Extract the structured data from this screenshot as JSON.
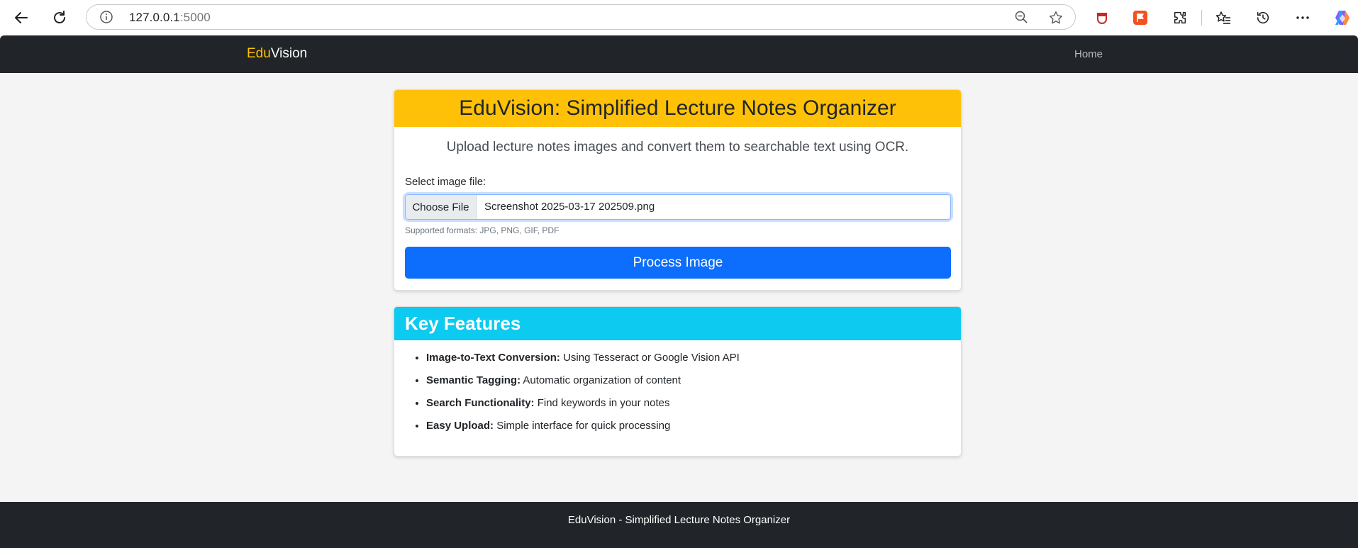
{
  "browser": {
    "url_host": "127.0.0.1",
    "url_port": ":5000",
    "icons": [
      "back-icon",
      "reload-icon",
      "info-icon",
      "zoom-out-icon",
      "star-icon",
      "shield-extension-icon",
      "flag-extension-icon",
      "puzzle-extensions-icon",
      "favorites-icon",
      "history-icon",
      "more-icon",
      "copilot-icon"
    ]
  },
  "navbar": {
    "brand_edu": "Edu",
    "brand_vision": "Vision",
    "home_link": "Home"
  },
  "upload_card": {
    "title": "EduVision: Simplified Lecture Notes Organizer",
    "lead": "Upload lecture notes images and convert them to searchable text using OCR.",
    "file_label": "Select image file:",
    "choose_button": "Choose File",
    "selected_file": "Screenshot 2025-03-17 202509.png",
    "help_text": "Supported formats: JPG, PNG, GIF, PDF",
    "submit_button": "Process Image"
  },
  "features_card": {
    "title": "Key Features",
    "items": [
      {
        "label": "Image-to-Text Conversion:",
        "text": " Using Tesseract or Google Vision API"
      },
      {
        "label": "Semantic Tagging:",
        "text": " Automatic organization of content"
      },
      {
        "label": "Search Functionality:",
        "text": " Find keywords in your notes"
      },
      {
        "label": "Easy Upload:",
        "text": " Simple interface for quick processing"
      }
    ]
  },
  "footer": {
    "text": "EduVision - Simplified Lecture Notes Organizer"
  },
  "colors": {
    "navbar_bg": "#212529",
    "brand_accent": "#ffc107",
    "upload_header": "#ffc107",
    "features_header": "#0dcaf0",
    "primary_button": "#0d6efd"
  }
}
